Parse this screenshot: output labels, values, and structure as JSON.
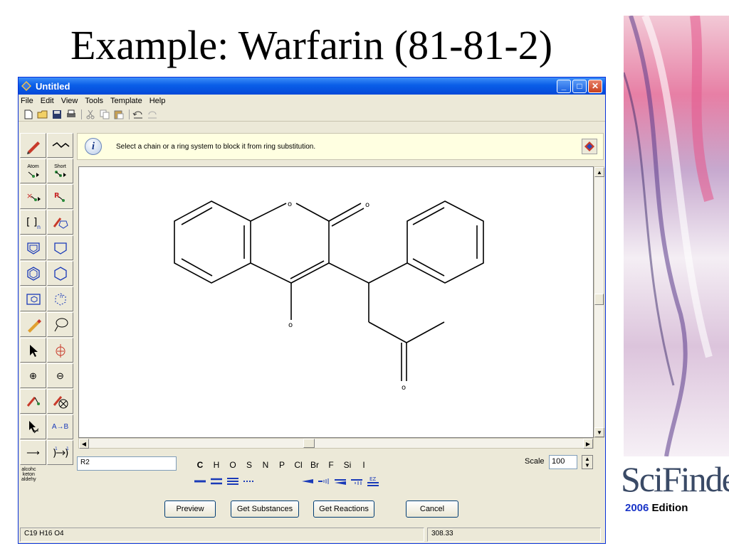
{
  "slide": {
    "title": "Example: Warfarin (81-81-2)",
    "logo_text": "SciFinder",
    "edition_year": "2006",
    "edition_label": " Edition"
  },
  "window": {
    "title": "Untitled",
    "controls": {
      "minimize": "_",
      "maximize": "□",
      "close": "✕"
    }
  },
  "menu": {
    "items": [
      {
        "key": "F",
        "rest": "ile"
      },
      {
        "key": "E",
        "rest": "dit"
      },
      {
        "key": "V",
        "rest": "iew"
      },
      {
        "key": "T",
        "rest": "ools",
        "prefix": "T",
        "keyAt": 1
      },
      {
        "key": "T",
        "rest": "emplate"
      },
      {
        "key": "H",
        "rest": "elp"
      }
    ],
    "labels": [
      "File",
      "Edit",
      "View",
      "Tools",
      "Template",
      "Help"
    ]
  },
  "toolbar": {
    "icons": [
      "new-file-icon",
      "open-folder-icon",
      "save-disk-icon",
      "print-icon",
      "cut-icon",
      "copy-icon",
      "paste-icon",
      "undo-icon",
      "redo-icon"
    ]
  },
  "palette": {
    "atom_label": "Atom",
    "short_label": "Short",
    "text_tool_label": "alcohc\nketon\naldehy",
    "arrow_label": "A→B",
    "zoom_in": "⊕",
    "zoom_out": "⊖",
    "reaction_arrow": "⟶"
  },
  "info": {
    "icon_glyph": "i",
    "message": "Select a chain or a ring system to block it from ring substitution."
  },
  "structure": {
    "atom_labels": [
      "o",
      "o",
      "o",
      "o"
    ],
    "name": "Warfarin"
  },
  "bottom": {
    "r_field_value": "R2",
    "elements": [
      "C",
      "H",
      "O",
      "S",
      "N",
      "P",
      "Cl",
      "Br",
      "F",
      "Si",
      "I"
    ],
    "active_element": "C",
    "bond_types": [
      "single",
      "double",
      "triple",
      "any"
    ],
    "stereo_types": [
      "wedge",
      "hash",
      "wedge-double",
      "hash-double",
      "ez"
    ],
    "ez_label": "EZ",
    "scale_label": "Scale",
    "scale_value": "100"
  },
  "buttons": {
    "preview": "Preview",
    "get_substances": "Get Substances",
    "get_reactions": "Get Reactions",
    "cancel": "Cancel"
  },
  "status": {
    "formula": "C19 H16 O4",
    "molecular_weight": "308.33"
  },
  "colors": {
    "title_bar": "#0a5ee8",
    "info_background": "#ffffe1",
    "window_face": "#ece9d8",
    "edition_year": "#1a35c8"
  }
}
